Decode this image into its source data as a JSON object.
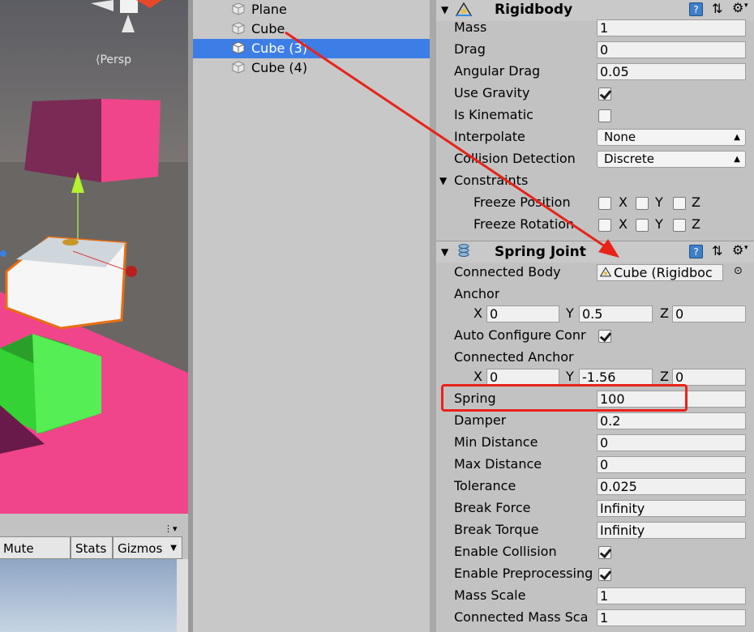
{
  "scene": {
    "persp_label": "Persp"
  },
  "game_toolbar": {
    "mute_audio": "Mute Audio",
    "stats": "Stats",
    "gizmos": "Gizmos"
  },
  "hierarchy": {
    "items": [
      {
        "label": "Plane",
        "selected": false
      },
      {
        "label": "Cube",
        "selected": false
      },
      {
        "label": "Cube (3)",
        "selected": true
      },
      {
        "label": "Cube (4)",
        "selected": false
      }
    ]
  },
  "rigidbody": {
    "title": "Rigidbody",
    "mass_label": "Mass",
    "mass": "1",
    "drag_label": "Drag",
    "drag": "0",
    "angular_drag_label": "Angular Drag",
    "angular_drag": "0.05",
    "use_gravity_label": "Use Gravity",
    "use_gravity": true,
    "is_kinematic_label": "Is Kinematic",
    "is_kinematic": false,
    "interpolate_label": "Interpolate",
    "interpolate": "None",
    "collision_detection_label": "Collision Detection",
    "collision_detection": "Discrete",
    "constraints_label": "Constraints",
    "freeze_position_label": "Freeze Position",
    "freeze_rotation_label": "Freeze Rotation",
    "axis_x": "X",
    "axis_y": "Y",
    "axis_z": "Z"
  },
  "spring_joint": {
    "title": "Spring Joint",
    "connected_body_label": "Connected Body",
    "connected_body": "Cube (Rigidboc",
    "anchor_label": "Anchor",
    "anchor": {
      "x": "0",
      "y": "0.5",
      "z": "0"
    },
    "auto_configure_label": "Auto Configure Conr",
    "auto_configure": true,
    "connected_anchor_label": "Connected Anchor",
    "connected_anchor": {
      "x": "0",
      "y": "-1.56",
      "z": "0"
    },
    "spring_label": "Spring",
    "spring": "100",
    "damper_label": "Damper",
    "damper": "0.2",
    "min_distance_label": "Min Distance",
    "min_distance": "0",
    "max_distance_label": "Max Distance",
    "max_distance": "0",
    "tolerance_label": "Tolerance",
    "tolerance": "0.025",
    "break_force_label": "Break Force",
    "break_force": "Infinity",
    "break_torque_label": "Break Torque",
    "break_torque": "Infinity",
    "enable_collision_label": "Enable Collision",
    "enable_collision": true,
    "enable_preprocessing_label": "Enable Preprocessing",
    "enable_preprocessing": true,
    "mass_scale_label": "Mass Scale",
    "mass_scale": "1",
    "connected_mass_scale_label": "Connected Mass Sca",
    "connected_mass_scale": "1"
  },
  "colors": {
    "selection": "#3d7ee6",
    "annotation_red": "#e8231a",
    "pink_cube": "#f0458a",
    "green_cube": "#3ad43a"
  }
}
